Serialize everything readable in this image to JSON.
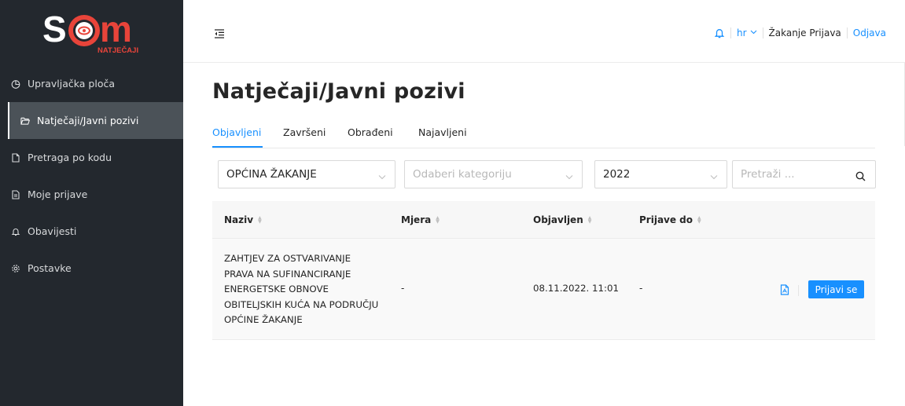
{
  "app": {
    "logo_text": "SOM",
    "logo_subtext": "NATJEČAJI"
  },
  "sidebar": {
    "items": [
      {
        "label": "Upravljačka ploča",
        "icon": "dashboard-icon"
      },
      {
        "label": "Natječaji/Javni pozivi",
        "icon": "folder-open-icon",
        "active": true
      },
      {
        "label": "Pretraga po kodu",
        "icon": "file-icon"
      },
      {
        "label": "Moje prijave",
        "icon": "file-text-icon"
      },
      {
        "label": "Obavijesti",
        "icon": "bell-icon"
      },
      {
        "label": "Postavke",
        "icon": "gear-icon"
      }
    ]
  },
  "header": {
    "language": "hr",
    "user_name": "Žakanje Prijava",
    "logout_label": "Odjava"
  },
  "main": {
    "title": "Natječaji/Javni pozivi",
    "tabs": [
      {
        "label": "Objavljeni",
        "active": true
      },
      {
        "label": "Završeni"
      },
      {
        "label": "Obrađeni"
      },
      {
        "label": "Najavljeni"
      }
    ],
    "filters": {
      "municipality": "OPĆINA ŽAKANJE",
      "category_placeholder": "Odaberi kategoriju",
      "year": "2022",
      "search_placeholder": "Pretraži ..."
    },
    "table": {
      "columns": [
        "Naziv",
        "Mjera",
        "Objavljen",
        "Prijave do"
      ],
      "rows": [
        {
          "naziv": "ZAHTJEV ZA OSTVARIVANJE PRAVA NA SUFINANCIRANJE ENERGETSKE OBNOVE OBITELJSKIH KUĆA NA PODRUČJU OPĆINE ŽAKANJE",
          "mjera": "-",
          "objavljen": "08.11.2022. 11:01",
          "prijave_do": "-",
          "action_label": "Prijavi se"
        }
      ]
    }
  },
  "colors": {
    "accent": "#1890ff",
    "sidebar_bg": "#23282e",
    "sidebar_active": "#4b5258",
    "logo_red": "#e8443a"
  }
}
